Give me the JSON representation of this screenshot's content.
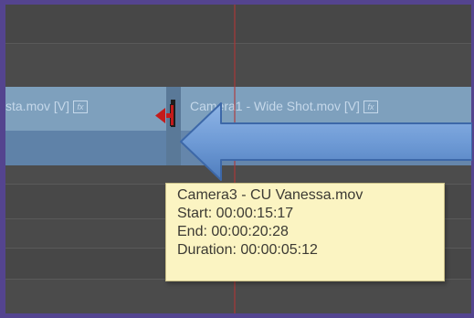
{
  "timeline": {
    "left_clip": {
      "name": "sta.mov [V]",
      "fx_badge": "fx"
    },
    "right_clip": {
      "name": "Camera1 - Wide Shot.mov [V]",
      "fx_badge": "fx"
    }
  },
  "tooltip": {
    "clip_name": "Camera3 - CU Vanessa.mov",
    "start": "Start: 00:00:15:17",
    "end": "End: 00:00:20:28",
    "duration": "Duration: 00:00:05:12"
  },
  "colors": {
    "frame": "#54448f",
    "clip_header": "#7ea0bd",
    "clip_body": "#5f82a8",
    "arrow": "#6f9bd6",
    "ripple_icon": "#c41b1b",
    "tooltip_bg": "#fbf4c2"
  },
  "icons": {
    "ripple_edit_cursor": "ripple-edit-cursor-icon",
    "callout_arrow": "left-arrow-icon"
  }
}
